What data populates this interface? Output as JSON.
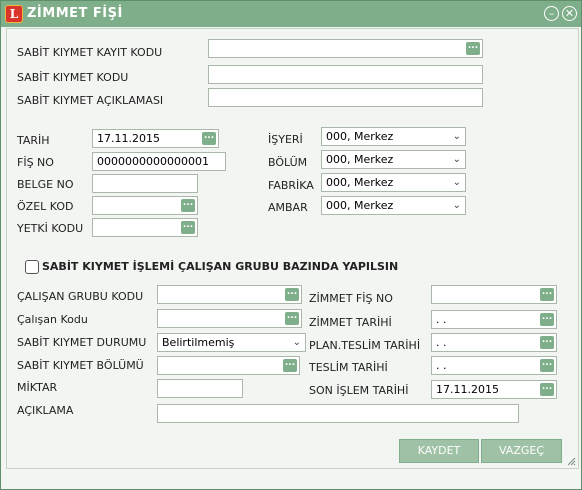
{
  "window": {
    "title": "ZİMMET FİŞİ",
    "app_icon": "L"
  },
  "titlebar_buttons": {
    "minimize_glyph": "⊖",
    "close_glyph": "✕"
  },
  "fields": {
    "sabit_kiymet_kayit_kodu": {
      "label": "SABİT KIYMET KAYIT KODU",
      "value": ""
    },
    "sabit_kiymet_kodu": {
      "label": "SABİT KIYMET KODU",
      "value": ""
    },
    "sabit_kiymet_aciklamasi": {
      "label": "SABİT KIYMET AÇIKLAMASI",
      "value": ""
    },
    "tarih": {
      "label": "TARİH",
      "value": "17.11.2015"
    },
    "fis_no": {
      "label": "FİŞ NO",
      "value": "0000000000000001"
    },
    "belge_no": {
      "label": "BELGE NO",
      "value": ""
    },
    "ozel_kod": {
      "label": "ÖZEL KOD",
      "value": ""
    },
    "yetki_kodu": {
      "label": "YETKİ KODU",
      "value": ""
    },
    "isyeri": {
      "label": "İŞYERİ",
      "value": "000, Merkez"
    },
    "bolum": {
      "label": "BÖLÜM",
      "value": "000, Merkez"
    },
    "fabrika": {
      "label": "FABRİKA",
      "value": "000, Merkez"
    },
    "ambar": {
      "label": "AMBAR",
      "value": "000, Merkez"
    },
    "calisan_grubu_kodu": {
      "label": "ÇALIŞAN GRUBU KODU",
      "value": ""
    },
    "calisan_kodu": {
      "label": "Çalışan Kodu",
      "value": ""
    },
    "sabit_kiymet_durumu": {
      "label": "SABİT KIYMET DURUMU",
      "value": "Belirtilmemiş"
    },
    "sabit_kiymet_bolumu": {
      "label": "SABİT KIYMET BÖLÜMÜ",
      "value": ""
    },
    "miktar": {
      "label": "MİKTAR",
      "value": ""
    },
    "aciklama": {
      "label": "AÇIKLAMA",
      "value": ""
    },
    "zimmet_fis_no": {
      "label": "ZİMMET FİŞ NO",
      "value": ""
    },
    "zimmet_tarihi": {
      "label": "ZİMMET TARİHİ",
      "value": ". ."
    },
    "plan_teslim_tarihi": {
      "label": "PLAN.TESLİM TARİHİ",
      "value": ". ."
    },
    "teslim_tarihi": {
      "label": "TESLİM TARİHİ",
      "value": ". ."
    },
    "son_islem_tarihi": {
      "label": "SON İŞLEM TARİHİ",
      "value": "17.11.2015"
    }
  },
  "checkbox": {
    "label": "SABİT KIYMET  İŞLEMİ ÇALIŞAN GRUBU BAZINDA YAPILSIN",
    "checked": false
  },
  "lookup_glyph": "...",
  "dropdown_glyph": "⌄",
  "buttons": {
    "save": "KAYDET",
    "cancel": "VAZGEÇ"
  },
  "colors": {
    "titlebar": "#7fae8a",
    "button": "#9fc1a5",
    "background": "#f2f5f2"
  }
}
